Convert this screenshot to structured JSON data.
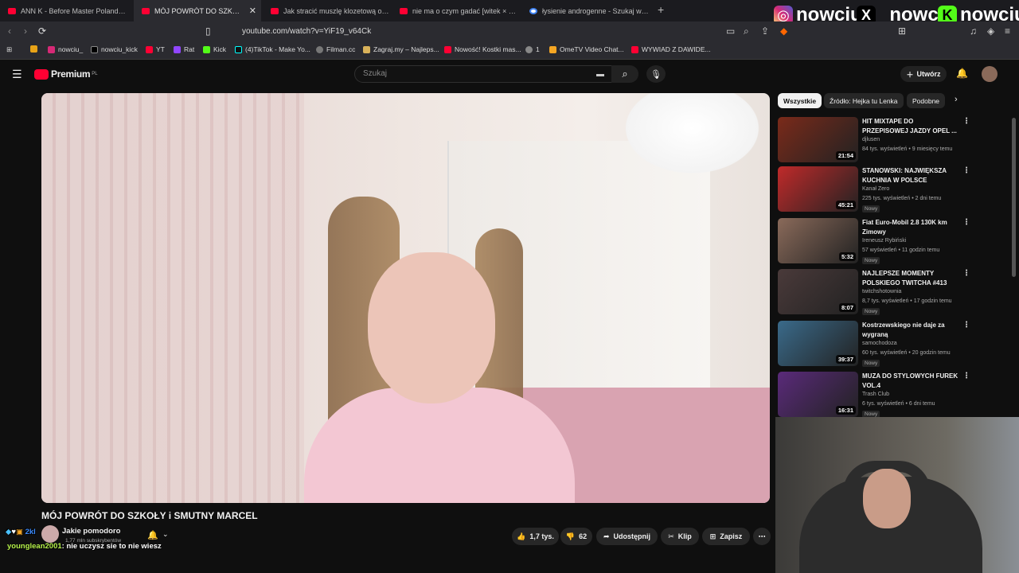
{
  "tabs": [
    {
      "title": "ANN K - Before Master Poland Dj Bat"
    },
    {
      "title": "MÓJ POWRÓT DO SZKOŁY i S"
    },
    {
      "title": "Jak stracić muszlę klozetową o półno"
    },
    {
      "title": "nie ma o czym gadać [witek × kasix o"
    },
    {
      "title": "łysienie androgenne - Szukaj w Goog"
    }
  ],
  "new_tab": "+",
  "social": [
    {
      "icon": "instagram-icon",
      "handle": "nowciu_",
      "color": "#e1306c"
    },
    {
      "icon": "x-icon",
      "handle": "_nowciu",
      "color": "#000000"
    },
    {
      "icon": "kick-icon",
      "handle": "nowciu",
      "color": "#53fc18"
    }
  ],
  "address": {
    "url": "youtube.com/watch?v=YiF19_v64Ck"
  },
  "bookmarks": [
    {
      "label": "",
      "icon": "apps-icon"
    },
    {
      "label": "nowciu_",
      "icon": "instagram-icon"
    },
    {
      "label": "nowciu_kick",
      "icon": "x-icon"
    },
    {
      "label": "YT",
      "icon": "youtube-icon"
    },
    {
      "label": "Rat",
      "icon": "twitch-icon"
    },
    {
      "label": "Kick",
      "icon": "kick-icon"
    },
    {
      "label": "(4)TikTok - Make Yo...",
      "icon": "tiktok-icon"
    },
    {
      "label": "Filman.cc",
      "icon": "filman-icon"
    },
    {
      "label": "Zagraj.my – Najleps...",
      "icon": "user-icon"
    },
    {
      "label": "Nowość! Kostki mas...",
      "icon": "youtube-icon"
    },
    {
      "label": "1",
      "icon": "globe-icon"
    },
    {
      "label": "OmeTV Video Chat...",
      "icon": "ometv-icon"
    },
    {
      "label": "WYWIAD Z DAWIDE...",
      "icon": "youtube-icon"
    }
  ],
  "yt": {
    "logo": "Premium",
    "logo_sup": "PL",
    "search_placeholder": "Szukaj",
    "create_label": "Utwórz"
  },
  "video": {
    "title": "MÓJ POWRÓT DO SZKOŁY i SMUTNY MARCEL",
    "channel": "Jakie pomodoro",
    "subscribers": "1,77 mln subskrybentów",
    "likes": "1,7 tys.",
    "dislikes": "62",
    "share": "Udostępnij",
    "clip": "Klip",
    "save": "Zapisz"
  },
  "chips": [
    "Wszystkie",
    "Źródło: Hejka tu Lenka",
    "Podobne"
  ],
  "sidebar": [
    {
      "title": "HIT MIXTAPE DO PRZEPISOWEJ JAZDY OPEL ...",
      "channel": "djlusen",
      "meta": "84 tys. wyświetleń • 9 miesięcy temu",
      "duration": "21:54",
      "badge": "",
      "thumb": "#7a2a1a"
    },
    {
      "title": "STANOWSKI: NAJWIĘKSZA KUCHNIA W POLSCE",
      "channel": "Kanał Zero",
      "meta": "225 tys. wyświetleń • 2 dni temu",
      "duration": "45:21",
      "badge": "Nowy",
      "thumb": "#c02a2a"
    },
    {
      "title": "Fiat Euro-Mobil 2.8 130K km Zimowy",
      "channel": "Ireneusz Rybiński",
      "meta": "57 wyświetleń • 11 godzin temu",
      "duration": "5:32",
      "badge": "Nowy",
      "thumb": "#8a6a5a"
    },
    {
      "title": "NAJLEPSZE MOMENTY POLSKIEGO TWITCHA #413",
      "channel": "twitchshotownia",
      "meta": "8,7 tys. wyświetleń • 17 godzin temu",
      "duration": "8:07",
      "badge": "Nowy",
      "thumb": "#4a3a3a"
    },
    {
      "title": "Kostrzewskiego nie daje za wygraną",
      "channel": "samochodoza",
      "meta": "60 tys. wyświetleń • 20 godzin temu",
      "duration": "39:37",
      "badge": "Nowy",
      "thumb": "#3a6a8a"
    },
    {
      "title": "MUZA DO STYLOWYCH FUREK VOL.4",
      "channel": "Trash Club",
      "meta": "6 tys. wyświetleń • 6 dni temu",
      "duration": "16:31",
      "badge": "Nowy",
      "thumb": "#5a2a7a"
    }
  ],
  "chat": {
    "line1_user": "2kl",
    "line2_user": "younglean2001",
    "line2_text": ": nie uczysz sie to nie wiesz",
    "line2_color": "#b6f24a"
  }
}
